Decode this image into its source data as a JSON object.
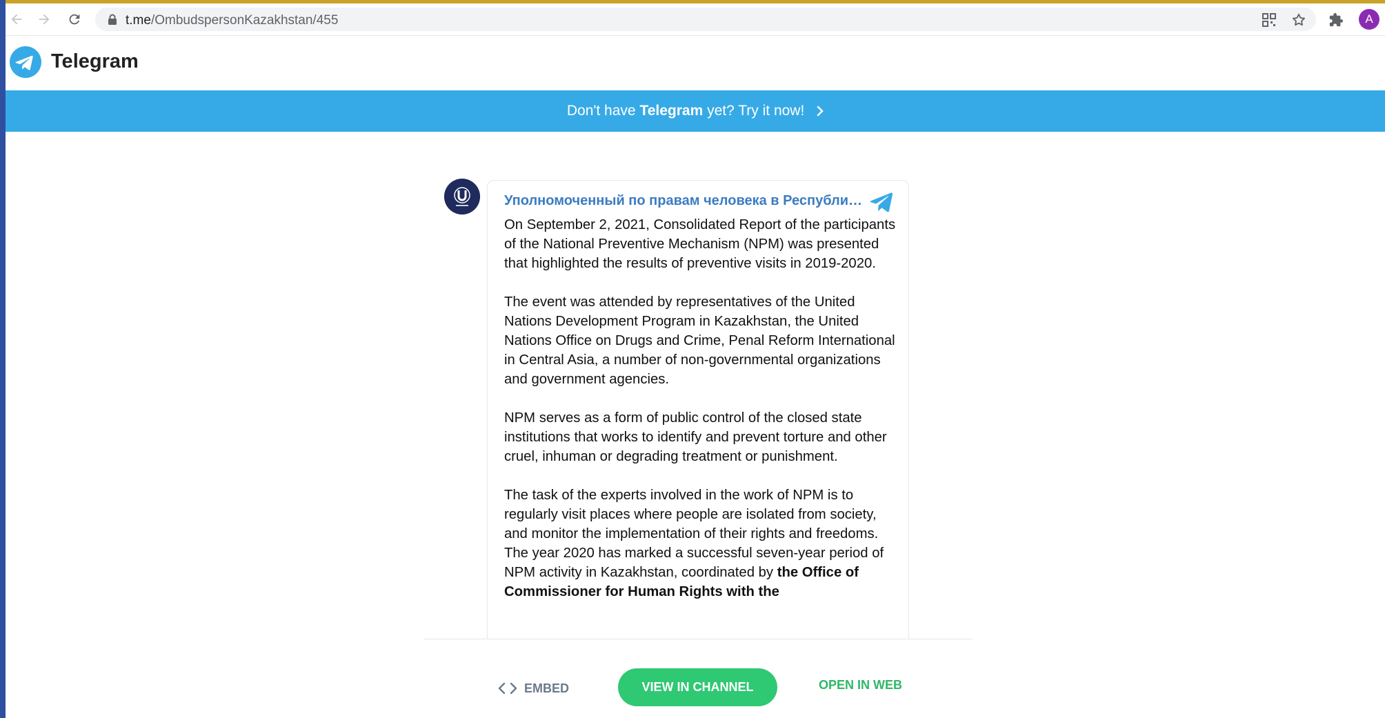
{
  "browser": {
    "url_host": "t.me",
    "url_path": "/OmbudspersonKazakhstan/455",
    "profile_initial": "A",
    "icons": [
      "back-icon",
      "forward-icon",
      "reload-icon",
      "lock-icon",
      "qr-code-icon",
      "star-icon",
      "extensions-icon"
    ]
  },
  "header": {
    "brand": "Telegram"
  },
  "banner": {
    "prefix": "Don't have ",
    "brand": "Telegram",
    "suffix": " yet? Try it now!"
  },
  "post": {
    "channel_name": "Уполномоченный по правам человека в Республике Казахстан",
    "paragraphs": [
      "On September 2, 2021, Consolidated Report of the participants of the National Preventive Mechanism (NPM) was presented that highlighted the results of preventive visits in 2019-2020.",
      "The event was attended by representatives of the United Nations Development Program in Kazakhstan, the United Nations Office on Drugs and Crime, Penal Reform International in Central Asia, a number of non-governmental organizations and government agencies.",
      "NPM serves as a form of public control of the closed state institutions that works to identify and prevent torture and other cruel, inhuman or degrading treatment or punishment."
    ],
    "last_paragraph": "The task of the experts involved in the work of NPM is to regularly visit places where people are isolated from society, and monitor the implementation of their rights and freedoms. The year 2020 has marked a successful seven-year period of NPM activity in Kazakhstan, coordinated by ",
    "last_paragraph_bold": "the Office of Commissioner for Human Rights with the"
  },
  "actions": {
    "embed": "EMBED",
    "view": "VIEW IN CHANNEL",
    "web": "OPEN IN WEB"
  },
  "colors": {
    "telegram_blue": "#36aae6",
    "link_blue": "#3a7cc2",
    "green": "#2fc873"
  }
}
